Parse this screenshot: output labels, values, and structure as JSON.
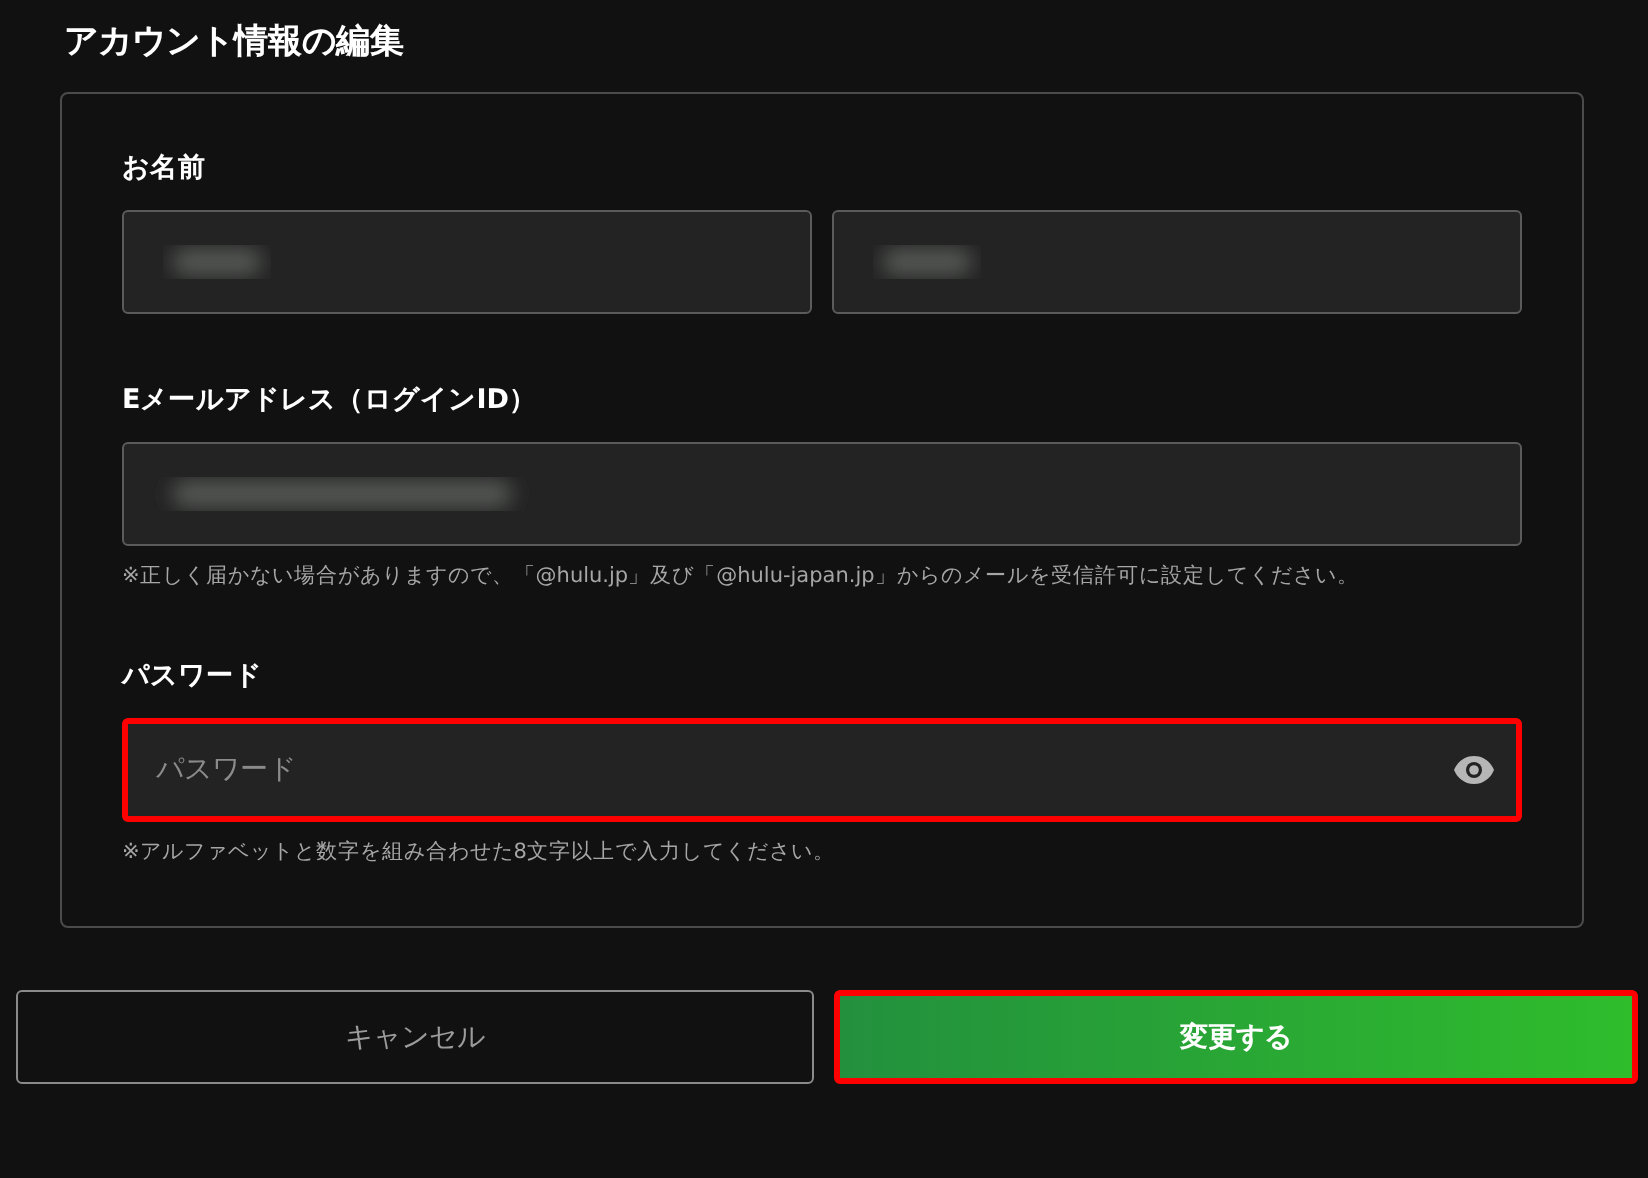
{
  "title": "アカウント情報の編集",
  "sections": [
    {
      "kind": "name",
      "label": "お名前",
      "fields": [
        {
          "redacted": true
        },
        {
          "redacted": true
        }
      ]
    },
    {
      "kind": "email",
      "label": "Eメールアドレス（ログインID）",
      "fields": [
        {
          "redacted": true
        }
      ],
      "note": "※正しく届かない場合がありますので、「@hulu.jp」及び「@hulu-japan.jp」からのメールを受信許可に設定してください。"
    },
    {
      "kind": "password",
      "label": "パスワード",
      "fields": [
        {
          "placeholder": "パスワード",
          "highlighted": true
        }
      ],
      "note": "※アルファベットと数字を組み合わせた8文字以上で入力してください。"
    }
  ],
  "buttons": [
    {
      "kind": "secondary",
      "label": "キャンセル",
      "highlighted": false
    },
    {
      "kind": "primary",
      "label": "変更する",
      "highlighted": true
    }
  ]
}
